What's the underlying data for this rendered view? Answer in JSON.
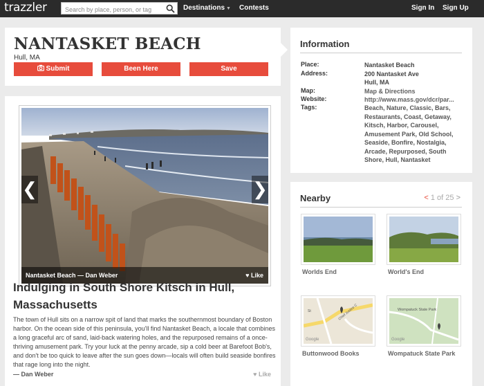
{
  "topbar": {
    "logo": "trazzler",
    "search_placeholder": "Search by place, person, or tag",
    "nav": {
      "destinations": "Destinations",
      "contests": "Contests",
      "sign_in": "Sign In",
      "sign_up": "Sign Up"
    }
  },
  "place": {
    "title": "NANTASKET BEACH",
    "city": "Hull, MA",
    "buttons": {
      "submit": "Submit",
      "been_here": "Been Here",
      "save": "Save"
    }
  },
  "info": {
    "heading": "Information",
    "place_label": "Place:",
    "place_value": "Nantasket Beach",
    "address_label": "Address:",
    "address_line1": "200 Nantasket Ave",
    "address_line2": "Hull, MA",
    "map_label": "Map:",
    "map_value": "Map & Directions",
    "website_label": "Website:",
    "website_value": "http://www.mass.gov/dcr/par...",
    "tags_label": "Tags:",
    "tags": "Beach, Nature, Classic, Bars, Restaurants, Coast, Getaway, Kitsch, Harbor, Carousel, Amusement Park, Old School, Seaside, Bonfire, Nostalgia, Arcade, Repurposed, South Shore, Hull, Nantasket"
  },
  "photo": {
    "caption": "Nantasket Beach — Dan Weber",
    "like": "Like"
  },
  "article": {
    "title": "Indulging in South Shore Kitsch in Hull, Massachusetts",
    "body": "The town of Hull sits on a narrow spit of land that marks the southernmost boundary of Boston harbor. On the ocean side of this peninsula, you'll find Nantasket Beach, a locale that combines a long graceful arc of sand, laid-back watering holes, and the repurposed remains of a once-thriving amusement park. Try your luck at the penny arcade, sip a cold beer at Barefoot Bob's, and don't be too quick to leave after the sun goes down—locals will often build seaside bonfires that rage long into the night.",
    "byline": "— Dan Weber",
    "like": "Like"
  },
  "nearby": {
    "heading": "Nearby",
    "pager_prev": "<",
    "pager_text": "1 of 25",
    "pager_next": ">",
    "items": [
      {
        "name": "Worlds End"
      },
      {
        "name": "World's End"
      },
      {
        "name": "Buttonwood Books"
      },
      {
        "name": "Wompatuck State Park"
      }
    ],
    "map_labels": {
      "google": "Google",
      "street": "Chief Justice C",
      "street_alt": "St",
      "park": "Wompatuck State Park"
    }
  },
  "colors": {
    "accent": "#e74c3c",
    "topbar": "#2b2b2b",
    "background": "#ebebeb"
  }
}
